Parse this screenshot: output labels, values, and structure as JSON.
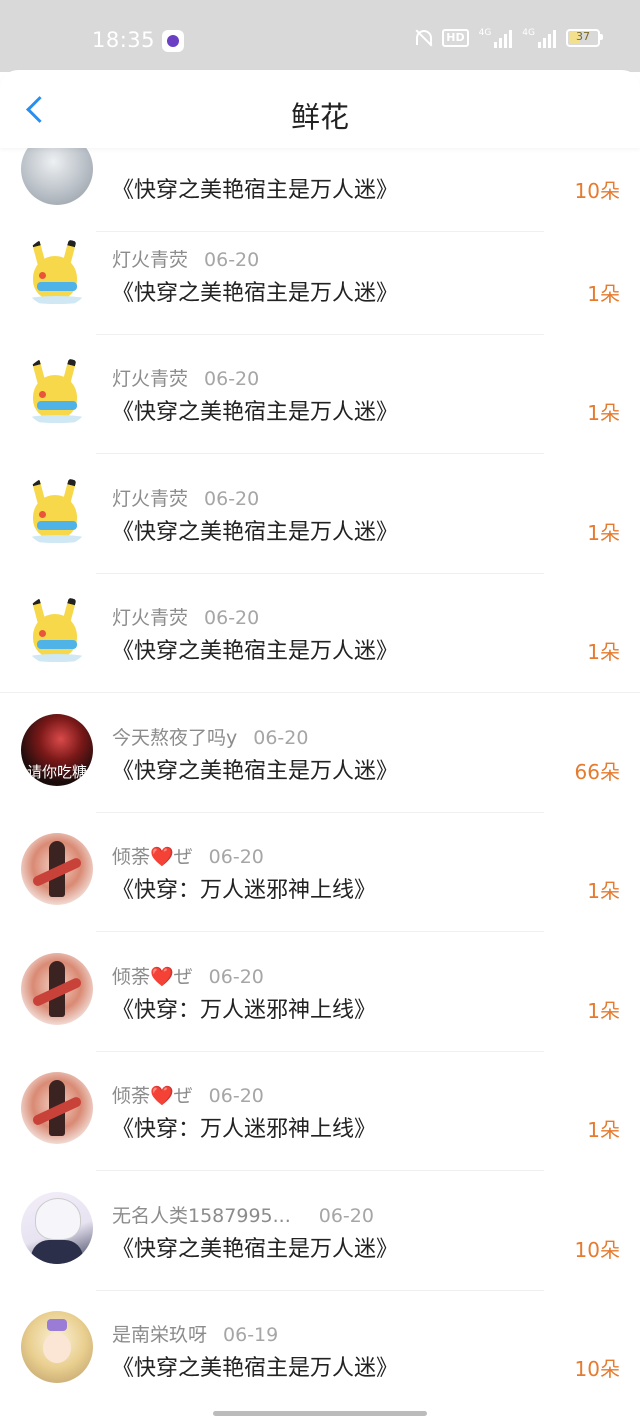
{
  "status_bar": {
    "time": "18:35",
    "hd": "HD",
    "signal1": "4G",
    "signal2": "4G",
    "battery": "37"
  },
  "header": {
    "title": "鲜花"
  },
  "items": [
    {
      "name": "",
      "date": "",
      "book": "《快穿之美艳宿主是万人迷》",
      "amount": "10朵",
      "avatar": "grey",
      "avatar_caption": ""
    },
    {
      "name": "灯火青荧",
      "date": "06-20",
      "book": "《快穿之美艳宿主是万人迷》",
      "amount": "1朵",
      "avatar": "pikachu",
      "avatar_caption": ""
    },
    {
      "name": "灯火青荧",
      "date": "06-20",
      "book": "《快穿之美艳宿主是万人迷》",
      "amount": "1朵",
      "avatar": "pikachu",
      "avatar_caption": ""
    },
    {
      "name": "灯火青荧",
      "date": "06-20",
      "book": "《快穿之美艳宿主是万人迷》",
      "amount": "1朵",
      "avatar": "pikachu",
      "avatar_caption": ""
    },
    {
      "name": "灯火青荧",
      "date": "06-20",
      "book": "《快穿之美艳宿主是万人迷》",
      "amount": "1朵",
      "avatar": "pikachu",
      "avatar_caption": ""
    },
    {
      "name": "今天熬夜了吗y",
      "date": "06-20",
      "book": "《快穿之美艳宿主是万人迷》",
      "amount": "66朵",
      "avatar": "dark",
      "avatar_caption": "请你吃糖"
    },
    {
      "name": "倾荼❤️ぜ",
      "date": "06-20",
      "book": "《快穿：万人迷邪神上线》",
      "amount": "1朵",
      "avatar": "doll",
      "avatar_caption": ""
    },
    {
      "name": "倾荼❤️ぜ",
      "date": "06-20",
      "book": "《快穿：万人迷邪神上线》",
      "amount": "1朵",
      "avatar": "doll",
      "avatar_caption": ""
    },
    {
      "name": "倾荼❤️ぜ",
      "date": "06-20",
      "book": "《快穿：万人迷邪神上线》",
      "amount": "1朵",
      "avatar": "doll",
      "avatar_caption": ""
    },
    {
      "name": "无名人类1587995...",
      "date": "06-20",
      "book": "《快穿之美艳宿主是万人迷》",
      "amount": "10朵",
      "avatar": "anime",
      "avatar_caption": ""
    },
    {
      "name": "是南栄玖呀",
      "date": "06-19",
      "book": "《快穿之美艳宿主是万人迷》",
      "amount": "10朵",
      "avatar": "gold",
      "avatar_caption": ""
    }
  ]
}
